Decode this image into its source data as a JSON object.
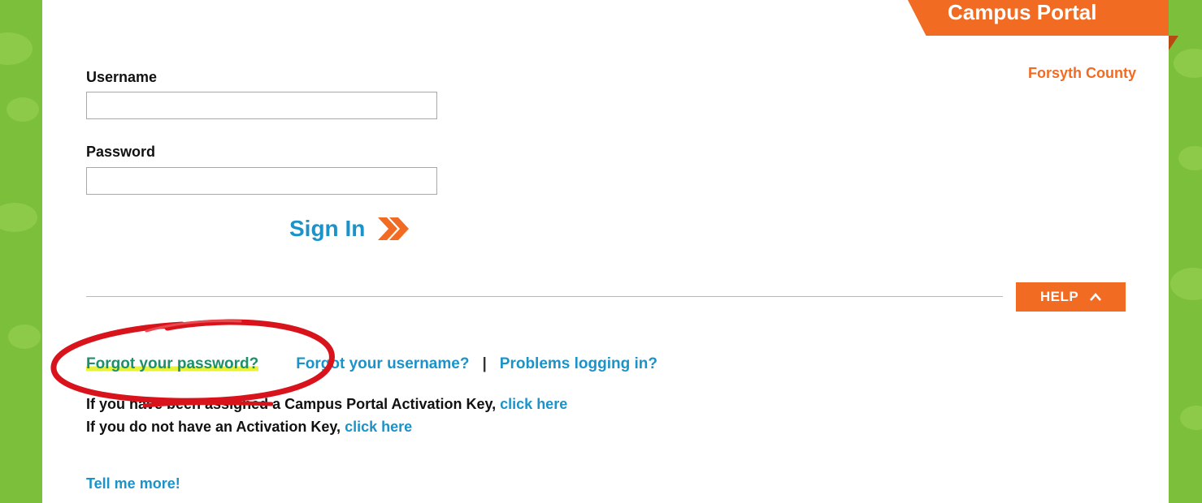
{
  "header": {
    "portal_title": "Campus Portal",
    "district": "Forsyth County"
  },
  "login": {
    "username_label": "Username",
    "username_value": "",
    "password_label": "Password",
    "password_value": "",
    "signin_label": "Sign In"
  },
  "help": {
    "button_label": "HELP",
    "forgot_password": "Forgot your password?",
    "forgot_username": "Forgot your username?",
    "separator": "|",
    "problems": "Problems logging in?",
    "activation_line1_text": "If you have been assigned a Campus Portal Activation Key,",
    "activation_line1_link": "click here",
    "activation_line2_text": "If you do not have an Activation Key,",
    "activation_line2_link": "click here",
    "tell_more": "Tell me more!"
  },
  "colors": {
    "accent_orange": "#f26b22",
    "link_blue": "#1c93c8",
    "background_green": "#7cbf3a",
    "annotation_red": "#d9131b"
  },
  "icons": {
    "signin_arrow": "double-chevron-right-icon",
    "help_chevron": "chevron-up-icon"
  }
}
